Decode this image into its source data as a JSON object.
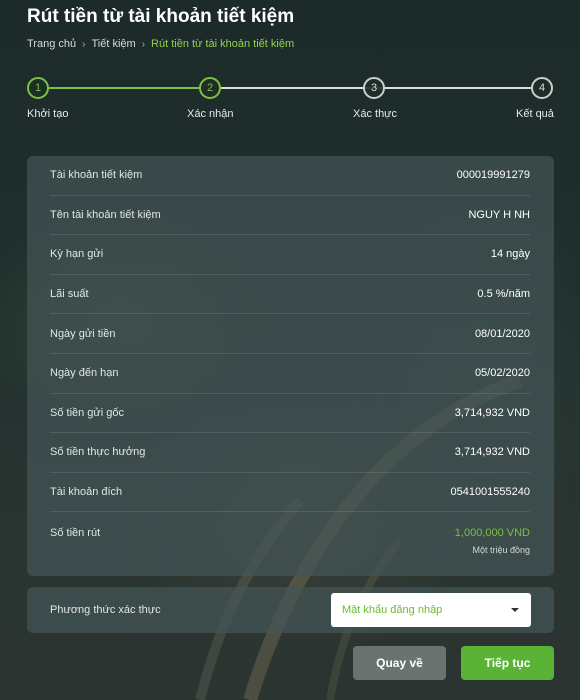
{
  "page_title": "Rút tiền từ tài khoản tiết kiệm",
  "breadcrumb": {
    "home": "Trang chủ",
    "parent": "Tiết kiệm",
    "current": "Rút tiền từ tài khoản tiết kiệm",
    "separator": "›"
  },
  "stepper": {
    "steps": [
      {
        "number": "1",
        "label": "Khởi tạo",
        "state": "done"
      },
      {
        "number": "2",
        "label": "Xác nhận",
        "state": "done"
      },
      {
        "number": "3",
        "label": "Xác thực",
        "state": "todo"
      },
      {
        "number": "4",
        "label": "Kết quả",
        "state": "todo"
      }
    ]
  },
  "details": {
    "rows": [
      {
        "label": "Tài khoản tiết kiệm",
        "value": "000019991279"
      },
      {
        "label": "Tên tài khoản tiết kiệm",
        "value": "NGUY H NH"
      },
      {
        "label": "Kỳ hạn gửi",
        "value": "14 ngày"
      },
      {
        "label": "Lãi suất",
        "value": "0.5 %/năm"
      },
      {
        "label": "Ngày gửi tiền",
        "value": "08/01/2020"
      },
      {
        "label": "Ngày đến hạn",
        "value": "05/02/2020"
      },
      {
        "label": "Số tiền gửi gốc",
        "value": "3,714,932 VND"
      },
      {
        "label": "Số tiền thực hưởng",
        "value": "3,714,932 VND"
      },
      {
        "label": "Tài khoản đích",
        "value": "0541001555240"
      }
    ],
    "withdraw": {
      "label": "Số tiền rút",
      "value": "1,000,000 VND",
      "in_words": "Một triệu đồng"
    }
  },
  "verification": {
    "label": "Phương thức xác thực",
    "selected": "Mật khẩu đăng nhập"
  },
  "buttons": {
    "back": "Quay về",
    "next": "Tiếp tục"
  },
  "colors": {
    "accent_green": "#7cc23e",
    "next_button": "#5bb336",
    "back_button": "#6b7372"
  }
}
